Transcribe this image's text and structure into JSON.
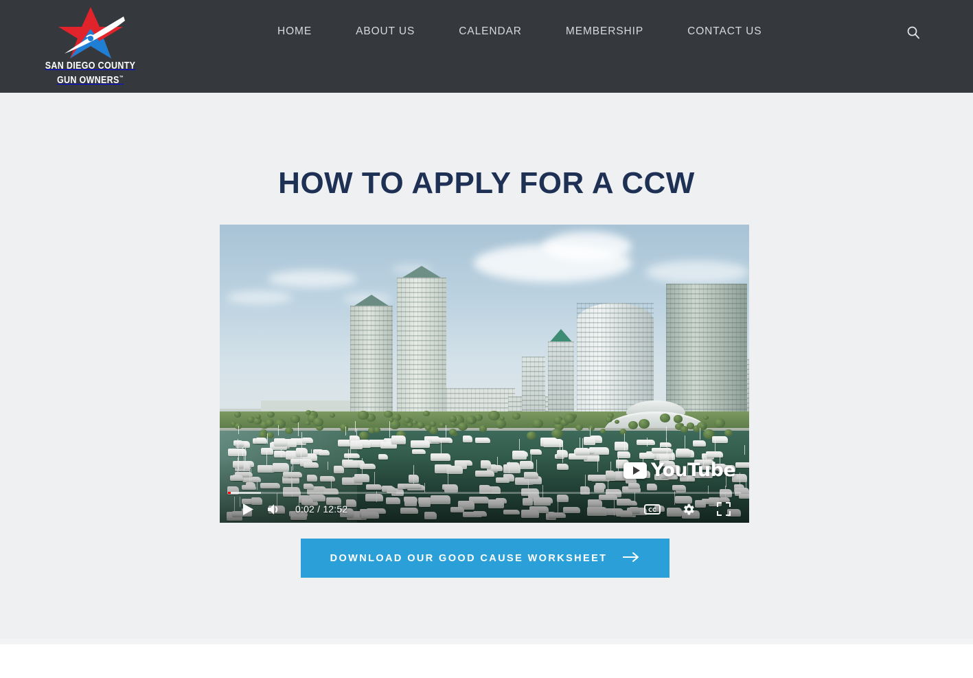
{
  "header": {
    "logo": {
      "line1": "SAN DIEGO COUNTY",
      "line2": "GUN OWNERS",
      "trademark": "™",
      "colors": {
        "star_red": "#e1242b",
        "star_blue": "#1f7fd4",
        "swoosh": "#ffffff"
      }
    },
    "nav_items": [
      {
        "label": "HOME"
      },
      {
        "label": "ABOUT US"
      },
      {
        "label": "CALENDAR"
      },
      {
        "label": "MEMBERSHIP"
      },
      {
        "label": "CONTACT US"
      }
    ],
    "search_icon": "search-icon",
    "background": "#35383d"
  },
  "main": {
    "title": "HOW TO APPLY FOR A CCW",
    "title_color": "#1e3155",
    "background": "#eff0f2"
  },
  "video": {
    "provider": "YouTube",
    "watermark_label": "YouTube",
    "current_time": "0:02",
    "duration": "12:52",
    "time_display": "0:02 / 12:52",
    "played_percent": 0.55,
    "loaded_percent": 6.4,
    "controls": {
      "play": "play-icon",
      "volume": "volume-icon",
      "captions": "closed-captions-icon",
      "settings": "settings-gear-icon",
      "fullscreen": "fullscreen-icon"
    },
    "scene_description": "San Diego downtown waterfront skyline with marina full of boats"
  },
  "cta": {
    "label": "DOWNLOAD OUR GOOD CAUSE WORKSHEET",
    "arrow_icon": "arrow-right-icon",
    "color": "#2ba0d8"
  }
}
